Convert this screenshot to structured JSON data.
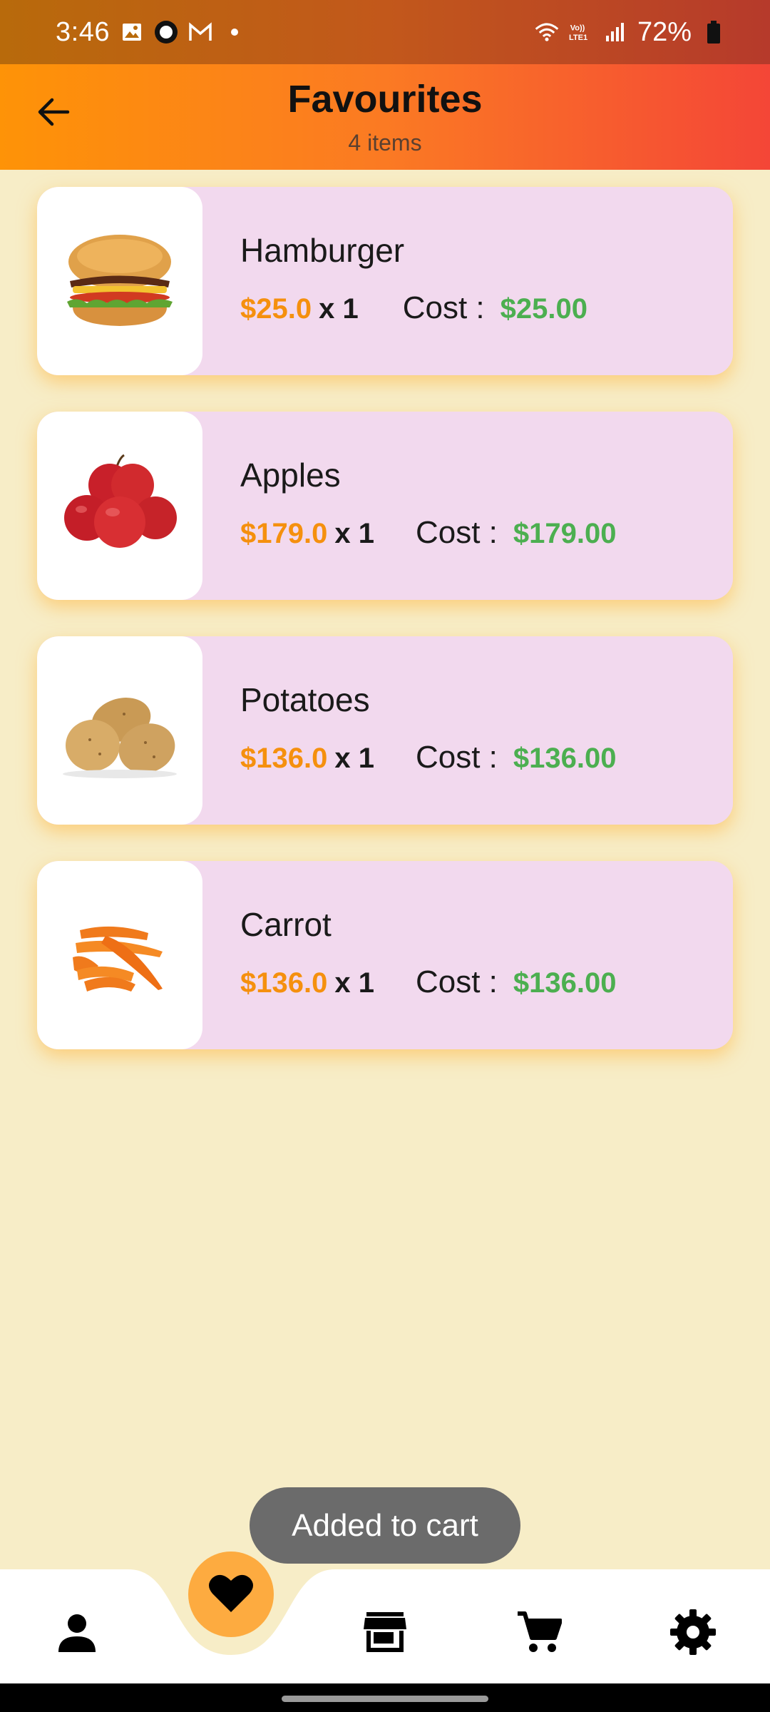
{
  "status_bar": {
    "time": "3:46",
    "battery": "72%",
    "icons": [
      "image-icon",
      "app-icon",
      "gmail-icon",
      "dot-icon",
      "wifi-icon",
      "volte-icon",
      "signal-icon",
      "battery-icon"
    ]
  },
  "header": {
    "title": "Favourites",
    "subtitle": "4 items",
    "back_icon": "arrow-back-icon"
  },
  "items": [
    {
      "name": "Hamburger",
      "price": "$25.0",
      "qty": "x 1",
      "cost_label": "Cost :",
      "cost": "$25.00",
      "image": "hamburger"
    },
    {
      "name": "Apples",
      "price": "$179.0",
      "qty": "x 1",
      "cost_label": "Cost :",
      "cost": "$179.00",
      "image": "apples"
    },
    {
      "name": "Potatoes",
      "price": "$136.0",
      "qty": "x 1",
      "cost_label": "Cost :",
      "cost": "$136.00",
      "image": "potatoes"
    },
    {
      "name": "Carrot",
      "price": "$136.0",
      "qty": "x 1",
      "cost_label": "Cost :",
      "cost": "$136.00",
      "image": "carrot"
    }
  ],
  "toast": {
    "text": "Added to cart"
  },
  "bottom_nav": {
    "items": [
      "person-icon",
      "heart-icon",
      "store-icon",
      "cart-icon",
      "settings-icon"
    ],
    "active": "heart-icon"
  },
  "colors": {
    "price": "#f5900e",
    "cost": "#4caf50",
    "card_bg": "#f2d9ee",
    "page_bg": "#f7edc7",
    "fab": "#fdab40"
  }
}
